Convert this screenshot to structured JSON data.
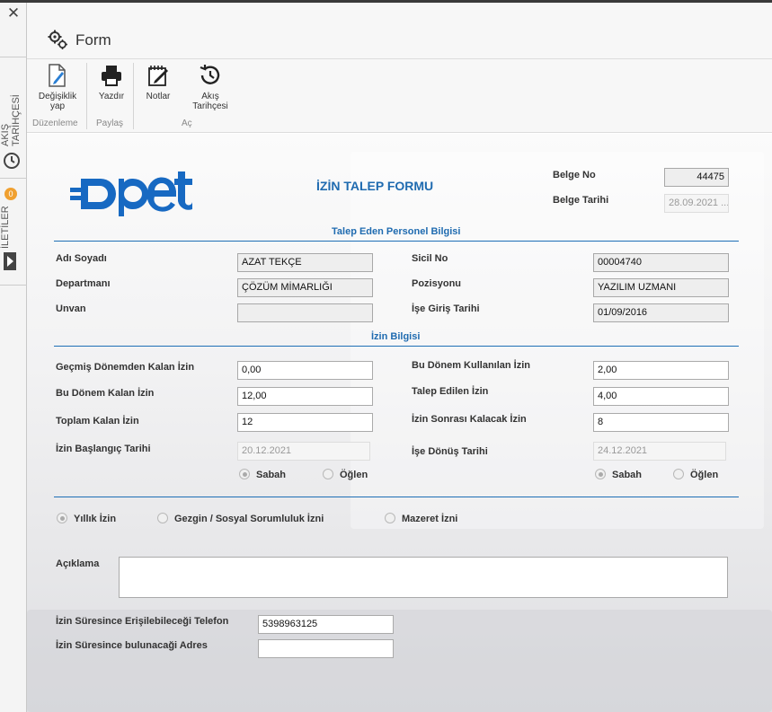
{
  "rail": {
    "close_glyph": "✕",
    "flow_history_tab": "AKIŞ TARİHÇESİ",
    "messages_tab": "İLETİLER",
    "messages_count": "0"
  },
  "header": {
    "title": "Form",
    "icon": "gears-icon"
  },
  "ribbon": {
    "edit_label_1": "Değişiklik",
    "edit_label_2": "yap",
    "print_label": "Yazdır",
    "notes_label": "Notlar",
    "history_label_1": "Akış",
    "history_label_2": "Tarihçesi",
    "group_edit": "Düzenleme",
    "group_share": "Paylaş",
    "group_open": "Aç"
  },
  "form": {
    "logo_text": "opet",
    "title": "İZİN TALEP FORMU",
    "doc_no_label": "Belge No",
    "doc_no_value": "44475",
    "doc_date_label": "Belge Tarihi",
    "doc_date_value": "28.09.2021 ...",
    "section_personnel": "Talep Eden Personel Bilgisi",
    "name_label": "Adı Soyadı",
    "name_value": "AZAT TEKÇE",
    "department_label": "Departmanı",
    "department_value": "ÇÖZÜM MİMARLIĞI",
    "title_label": "Unvan",
    "title_value": "",
    "registry_label": "Sicil No",
    "registry_value": "00004740",
    "position_label": "Pozisyonu",
    "position_value": "YAZILIM UZMANI",
    "hire_date_label": "İşe Giriş Tarihi",
    "hire_date_value": "01/09/2016",
    "section_leave": "İzin Bilgisi",
    "prev_remaining_label": "Geçmiş Dönemden Kalan İzin",
    "prev_remaining_value": "0,00",
    "period_remaining_label": "Bu Dönem Kalan İzin",
    "period_remaining_value": "12,00",
    "total_remaining_label": "Toplam Kalan İzin",
    "total_remaining_value": "12",
    "start_date_label": "İzin Başlangıç Tarihi",
    "start_date_value": "20.12.2021",
    "period_used_label": "Bu Dönem Kullanılan İzin",
    "period_used_value": "2,00",
    "requested_label": "Talep Edilen İzin",
    "requested_value": "4,00",
    "after_leave_label": "İzin Sonrası Kalacak İzin",
    "after_leave_value": "8",
    "return_date_label": "İşe Dönüş Tarihi",
    "return_date_value": "24.12.2021",
    "morning_label": "Sabah",
    "noon_label": "Öğlen",
    "type_annual": "Yıllık İzin",
    "type_mobile": "Gezgin / Sosyal Sorumluluk İzni",
    "type_excuse": "Mazeret İzni",
    "description_label": "Açıklama",
    "description_value": "",
    "phone_label": "İzin Süresince Erişilebileceği Telefon",
    "phone_value": "5398963125",
    "address_label": "İzin Süresince bulunacaği Adres",
    "address_value": ""
  },
  "colors": {
    "accent": "#1f6bb0",
    "logo": "#1769c2"
  }
}
